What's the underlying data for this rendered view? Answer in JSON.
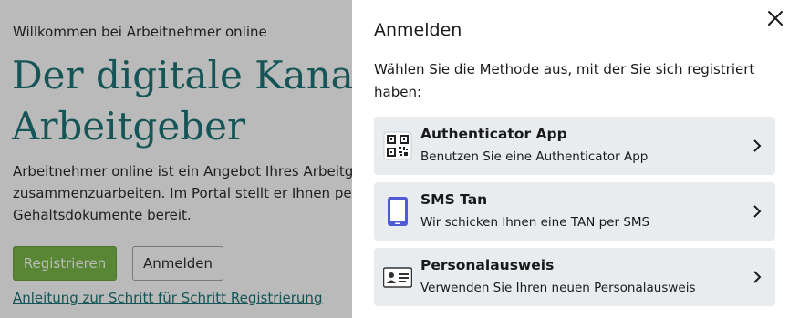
{
  "background": {
    "welcome": "Willkommen bei Arbeitnehmer online",
    "hero_title_line1": "Der digitale Kanal",
    "hero_title_line2": "Arbeitgeber",
    "intro_line1": "Arbeitnehmer online ist ein Angebot Ihres Arbeitgebers",
    "intro_line2": "zusammenzuarbeiten. Im Portal stellt er Ihnen persönliche",
    "intro_line3": "Gehaltsdokumente bereit.",
    "register_label": "Registrieren",
    "login_label": "Anmelden",
    "guide_link": "Anleitung zur Schritt für Schritt Registrierung"
  },
  "drawer": {
    "title": "Anmelden",
    "subtitle": "Wählen Sie die Methode aus, mit der Sie sich registriert haben:",
    "methods": [
      {
        "icon": "qr-code-icon",
        "title": "Authenticator App",
        "description": "Benutzen Sie eine Authenticator App"
      },
      {
        "icon": "smartphone-icon",
        "title": "SMS Tan",
        "description": "Wir schicken Ihnen eine TAN per SMS"
      },
      {
        "icon": "id-card-icon",
        "title": "Personalausweis",
        "description": "Verwenden Sie Ihren neuen Personalausweis"
      }
    ]
  },
  "colors": {
    "brand_teal": "#0e6b6e",
    "register_green": "#6fb33a",
    "method_bg": "#e9ecef",
    "phone_blue": "#4f5bd5"
  }
}
